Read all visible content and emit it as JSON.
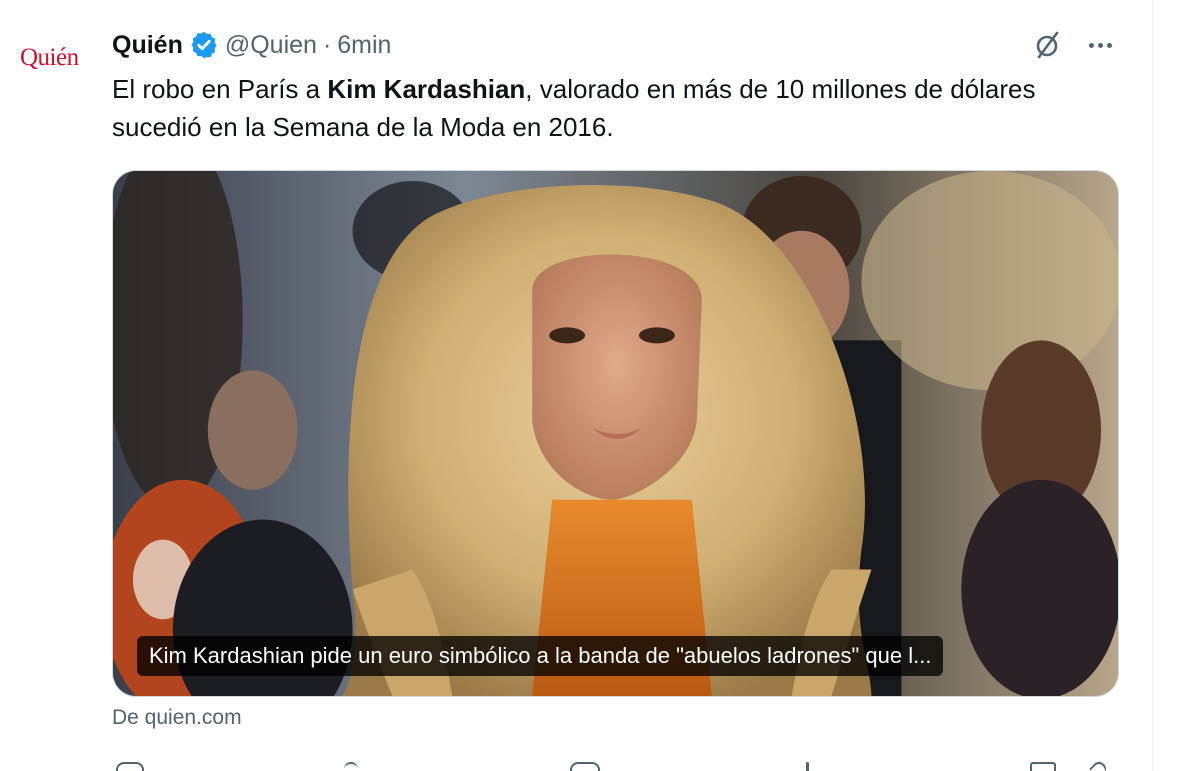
{
  "tweet": {
    "display_name": "Quién",
    "handle": "@Quien",
    "separator": "·",
    "time": "6min",
    "avatar_text": "Quién",
    "text_before": "El robo en París a ",
    "text_bold": "Kim Kardashian",
    "text_after": ", valorado en más de 10 millones de dólares sucedió en la Semana de la Moda en 2016."
  },
  "card": {
    "title": "Kim Kardashian pide un euro simbólico a la banda de \"abuelos ladrones\" que l...",
    "source": "De quien.com"
  },
  "icons": {
    "verified": "verified-badge-icon",
    "grok": "grok-icon",
    "more": "more-options-icon",
    "actions": [
      "reply-icon",
      "repost-icon",
      "like-icon",
      "views-icon",
      "bookmark-icon",
      "share-icon"
    ]
  },
  "colors": {
    "brand_red": "#d0112b",
    "verified_blue": "#1d9bf0",
    "secondary_text": "#536471",
    "primary_text": "#0f1419"
  }
}
